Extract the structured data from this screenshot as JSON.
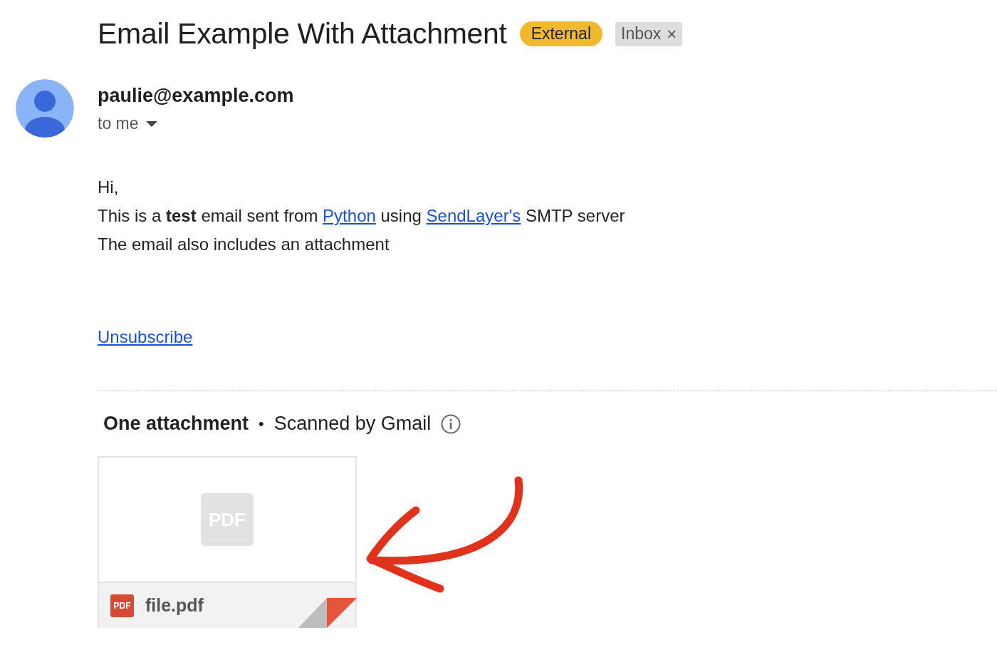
{
  "subject": "Email Example With Attachment",
  "labels": [
    {
      "text": "External",
      "kind": "badge",
      "removable": false
    },
    {
      "text": "Inbox",
      "kind": "chip",
      "removable": true,
      "remove_glyph": "×"
    }
  ],
  "sender": {
    "address": "paulie@example.com",
    "recipient": "to me"
  },
  "body": [
    [
      {
        "kind": "text",
        "text": "Hi,"
      }
    ],
    [
      {
        "kind": "text",
        "text": "This is a **test** email sent from "
      },
      {
        "kind": "link",
        "text": "Python"
      },
      {
        "kind": "text",
        "text": " using "
      },
      {
        "kind": "link",
        "text": "SendLayer's"
      },
      {
        "kind": "text",
        "text": " SMTP server"
      }
    ],
    [
      {
        "kind": "text",
        "text": "The email also includes an attachment"
      }
    ]
  ],
  "unsubscribe": "Unsubscribe",
  "attachments_header": {
    "title": "One attachment",
    "separator": "•",
    "scan_note": "Scanned by Gmail"
  },
  "attachments": [
    {
      "file_name": "file.pdf",
      "preview_label": "PDF",
      "type_label": "PDF"
    }
  ]
}
